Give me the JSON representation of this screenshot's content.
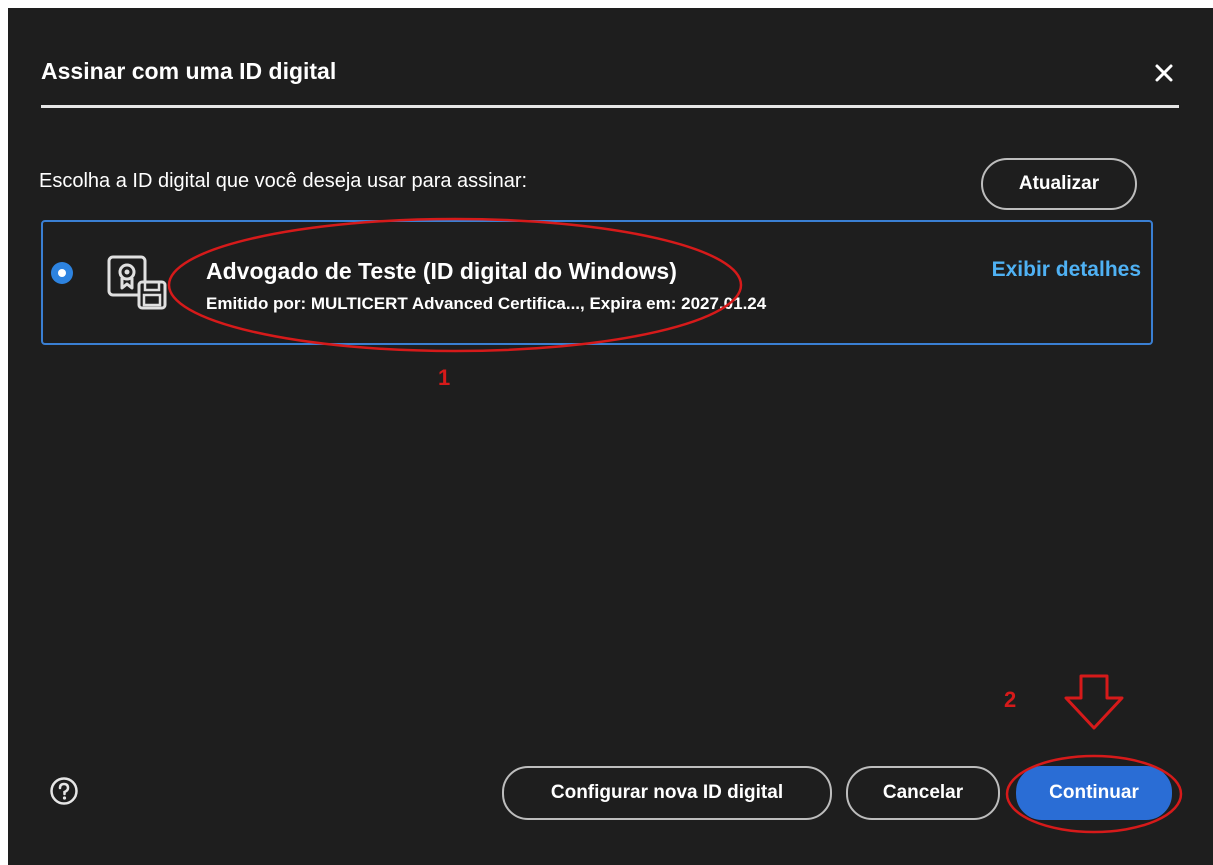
{
  "dialog": {
    "title": "Assinar com uma ID digital",
    "prompt": "Escolha a ID digital que você deseja usar para assinar:",
    "refresh_label": "Atualizar",
    "digital_id": {
      "name": "Advogado de Teste (ID digital do Windows)",
      "issuer": "Emitido por: MULTICERT Advanced Certifica..., Expira em: 2027.01.24",
      "details_link": "Exibir detalhes",
      "selected": true,
      "icon": "certificate-icon"
    },
    "footer": {
      "help_icon": "help-icon",
      "configure_label": "Configurar nova ID digital",
      "cancel_label": "Cancelar",
      "continue_label": "Continuar"
    }
  },
  "annotations": {
    "step1": "1",
    "step2": "2"
  },
  "colors": {
    "dialog_bg": "#1e1e1e",
    "accent": "#2a6dd5",
    "link": "#4fb1f3",
    "annotation": "#d61a1a"
  }
}
